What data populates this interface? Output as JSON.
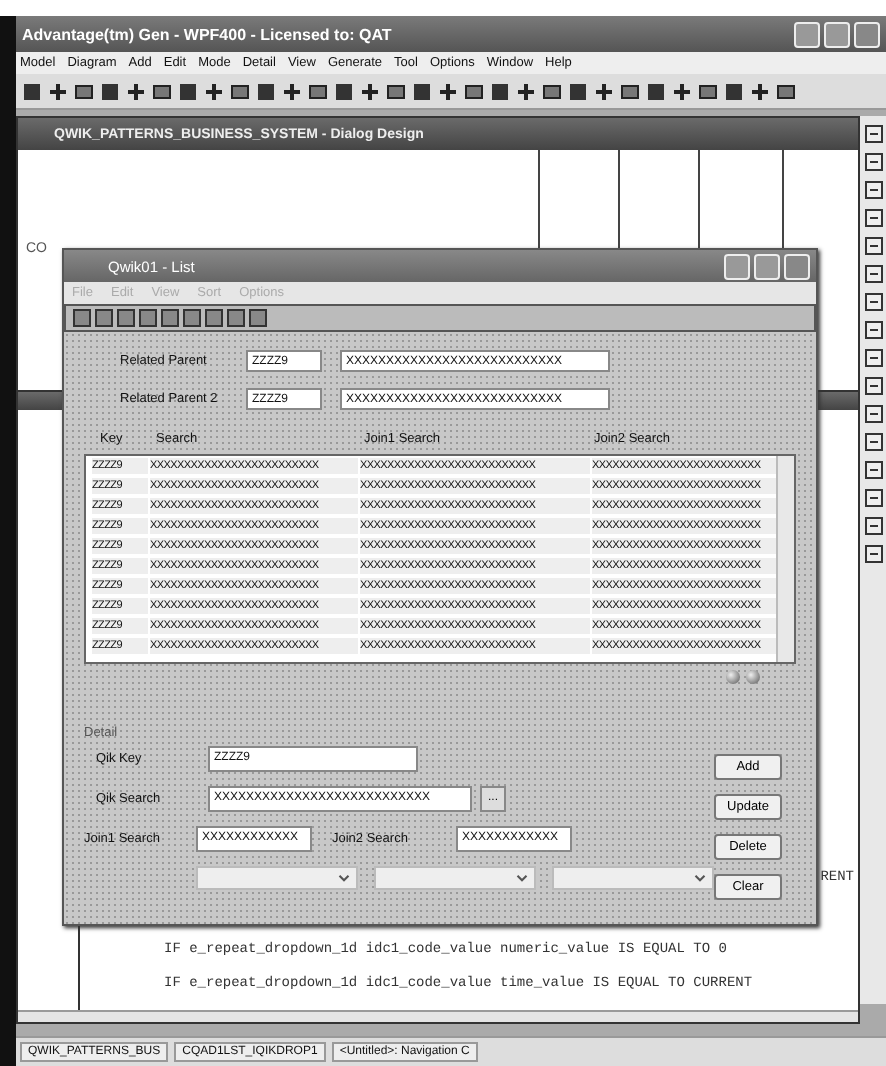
{
  "window": {
    "title": "Advantage(tm) Gen - WPF400 - Licensed to:  QAT"
  },
  "menu": [
    "Model",
    "Diagram",
    "Add",
    "Edit",
    "Mode",
    "Detail",
    "View",
    "Generate",
    "Tool",
    "Options",
    "Window",
    "Help"
  ],
  "design_window": {
    "title": "QWIK_PATTERNS_BUSINESS_SYSTEM - Dialog Design",
    "label": "CO"
  },
  "code_window": {
    "cut_text": "RENT",
    "lines": [
      "IF e_repeat_dropdown_1d idc1_code_value numeric_value IS EQUAL TO 0",
      "IF e_repeat_dropdown_1d idc1_code_value time_value IS EQUAL TO CURRENT"
    ]
  },
  "dialog": {
    "title": "Qwik01 - List",
    "menu": [
      {
        "label": "File",
        "disabled": true
      },
      {
        "label": "Edit",
        "disabled": true
      },
      {
        "label": "View",
        "disabled": true
      },
      {
        "label": "Sort",
        "disabled": true
      },
      {
        "label": "Options",
        "disabled": true
      }
    ],
    "parents": [
      {
        "label": "Related Parent",
        "key": "ZZZZ9",
        "value": "XXXXXXXXXXXXXXXXXXXXXXXXXXX"
      },
      {
        "label": "Related Parent 2",
        "key": "ZZZZ9",
        "value": "XXXXXXXXXXXXXXXXXXXXXXXXXXX"
      }
    ],
    "table": {
      "columns": [
        "Key",
        "Search",
        "Join1 Search",
        "Join2 Search"
      ],
      "rows": [
        [
          "ZZZZ9",
          "XXXXXXXXXXXXXXXXXXXXXXXXX",
          "XXXXXXXXXXXXXXXXXXXXXXXXXX",
          "XXXXXXXXXXXXXXXXXXXXXXXXX"
        ],
        [
          "ZZZZ9",
          "XXXXXXXXXXXXXXXXXXXXXXXXX",
          "XXXXXXXXXXXXXXXXXXXXXXXXXX",
          "XXXXXXXXXXXXXXXXXXXXXXXXX"
        ],
        [
          "ZZZZ9",
          "XXXXXXXXXXXXXXXXXXXXXXXXX",
          "XXXXXXXXXXXXXXXXXXXXXXXXXX",
          "XXXXXXXXXXXXXXXXXXXXXXXXX"
        ],
        [
          "ZZZZ9",
          "XXXXXXXXXXXXXXXXXXXXXXXXX",
          "XXXXXXXXXXXXXXXXXXXXXXXXXX",
          "XXXXXXXXXXXXXXXXXXXXXXXXX"
        ],
        [
          "ZZZZ9",
          "XXXXXXXXXXXXXXXXXXXXXXXXX",
          "XXXXXXXXXXXXXXXXXXXXXXXXXX",
          "XXXXXXXXXXXXXXXXXXXXXXXXX"
        ],
        [
          "ZZZZ9",
          "XXXXXXXXXXXXXXXXXXXXXXXXX",
          "XXXXXXXXXXXXXXXXXXXXXXXXXX",
          "XXXXXXXXXXXXXXXXXXXXXXXXX"
        ],
        [
          "ZZZZ9",
          "XXXXXXXXXXXXXXXXXXXXXXXXX",
          "XXXXXXXXXXXXXXXXXXXXXXXXXX",
          "XXXXXXXXXXXXXXXXXXXXXXXXX"
        ],
        [
          "ZZZZ9",
          "XXXXXXXXXXXXXXXXXXXXXXXXX",
          "XXXXXXXXXXXXXXXXXXXXXXXXXX",
          "XXXXXXXXXXXXXXXXXXXXXXXXX"
        ],
        [
          "ZZZZ9",
          "XXXXXXXXXXXXXXXXXXXXXXXXX",
          "XXXXXXXXXXXXXXXXXXXXXXXXXX",
          "XXXXXXXXXXXXXXXXXXXXXXXXX"
        ],
        [
          "ZZZZ9",
          "XXXXXXXXXXXXXXXXXXXXXXXXX",
          "XXXXXXXXXXXXXXXXXXXXXXXXXX",
          "XXXXXXXXXXXXXXXXXXXXXXXXX"
        ]
      ]
    },
    "detail": {
      "title": "Detail",
      "key_label": "Qik Key",
      "key": "ZZZZ9",
      "search_label": "Qik Search",
      "search": "XXXXXXXXXXXXXXXXXXXXXXXXXXX",
      "browse": "...",
      "join1_label": "Join1 Search",
      "join1": "XXXXXXXXXXXX",
      "join2_label": "Join2 Search",
      "join2": "XXXXXXXXXXXX"
    },
    "buttons": [
      "Add",
      "Update",
      "Delete",
      "Clear"
    ]
  },
  "taskbar": [
    "QWIK_PATTERNS_BUS",
    "CQAD1LST_IQIKDROP1",
    "<Untitled>:  Navigation C"
  ]
}
